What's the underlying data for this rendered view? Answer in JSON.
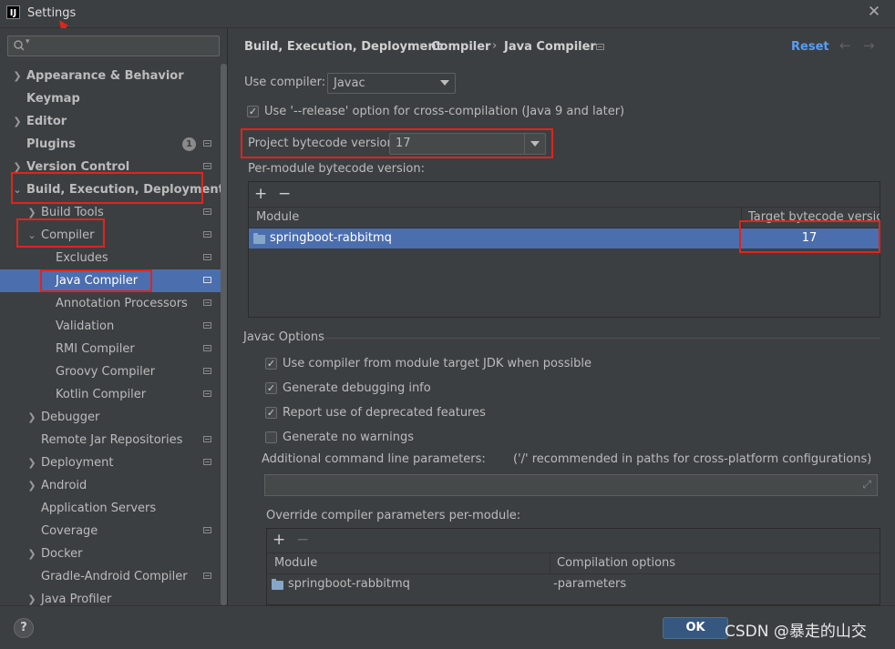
{
  "window": {
    "title": "Settings",
    "app_icon": "IJ"
  },
  "sidebar": {
    "search_placeholder": "",
    "items": [
      {
        "label": "Appearance & Behavior"
      },
      {
        "label": "Keymap"
      },
      {
        "label": "Editor"
      },
      {
        "label": "Plugins",
        "badge": "1"
      },
      {
        "label": "Version Control"
      },
      {
        "label": "Build, Execution, Deployment"
      },
      {
        "label": "Build Tools"
      },
      {
        "label": "Compiler"
      },
      {
        "label": "Excludes"
      },
      {
        "label": "Java Compiler"
      },
      {
        "label": "Annotation Processors"
      },
      {
        "label": "Validation"
      },
      {
        "label": "RMI Compiler"
      },
      {
        "label": "Groovy Compiler"
      },
      {
        "label": "Kotlin Compiler"
      },
      {
        "label": "Debugger"
      },
      {
        "label": "Remote Jar Repositories"
      },
      {
        "label": "Deployment"
      },
      {
        "label": "Android"
      },
      {
        "label": "Application Servers"
      },
      {
        "label": "Coverage"
      },
      {
        "label": "Docker"
      },
      {
        "label": "Gradle-Android Compiler"
      },
      {
        "label": "Java Profiler"
      }
    ]
  },
  "breadcrumb": [
    "Build, Execution, Deployment",
    "Java Compiler"
  ],
  "breadcrumb_mid": "Compiler",
  "breadcrumb_sep": "›",
  "reset_label": "Reset",
  "use_compiler": {
    "label": "Use compiler:",
    "value": "Javac"
  },
  "release_option": {
    "label": "Use '--release' option for cross-compilation (Java 9 and later)",
    "checked": true
  },
  "project_bytecode": {
    "label": "Project bytecode version:",
    "value": "17"
  },
  "per_module": {
    "label": "Per-module bytecode version:",
    "columns": [
      "Module",
      "Target bytecode version"
    ],
    "rows": [
      {
        "module": "springboot-rabbitmq",
        "target": "17"
      }
    ]
  },
  "javac_options": {
    "title": "Javac Options",
    "checks": [
      {
        "label": "Use compiler from module target JDK when possible",
        "checked": true
      },
      {
        "label": "Generate debugging info",
        "checked": true
      },
      {
        "label": "Report use of deprecated features",
        "checked": true
      },
      {
        "label": "Generate no warnings",
        "checked": false
      }
    ],
    "additional_label": "Additional command line parameters:",
    "additional_hint": "('/' recommended in paths for cross-platform configurations)",
    "additional_value": ""
  },
  "override": {
    "label": "Override compiler parameters per-module:",
    "columns": [
      "Module",
      "Compilation options"
    ],
    "rows": [
      {
        "module": "springboot-rabbitmq",
        "options": "-parameters"
      }
    ]
  },
  "buttons": {
    "ok": "OK",
    "help": "?"
  },
  "watermark": "CSDN @暴走的山交",
  "colors": {
    "selection": "#4b6eaf",
    "highlight": "#e0241c",
    "link": "#589df6"
  }
}
